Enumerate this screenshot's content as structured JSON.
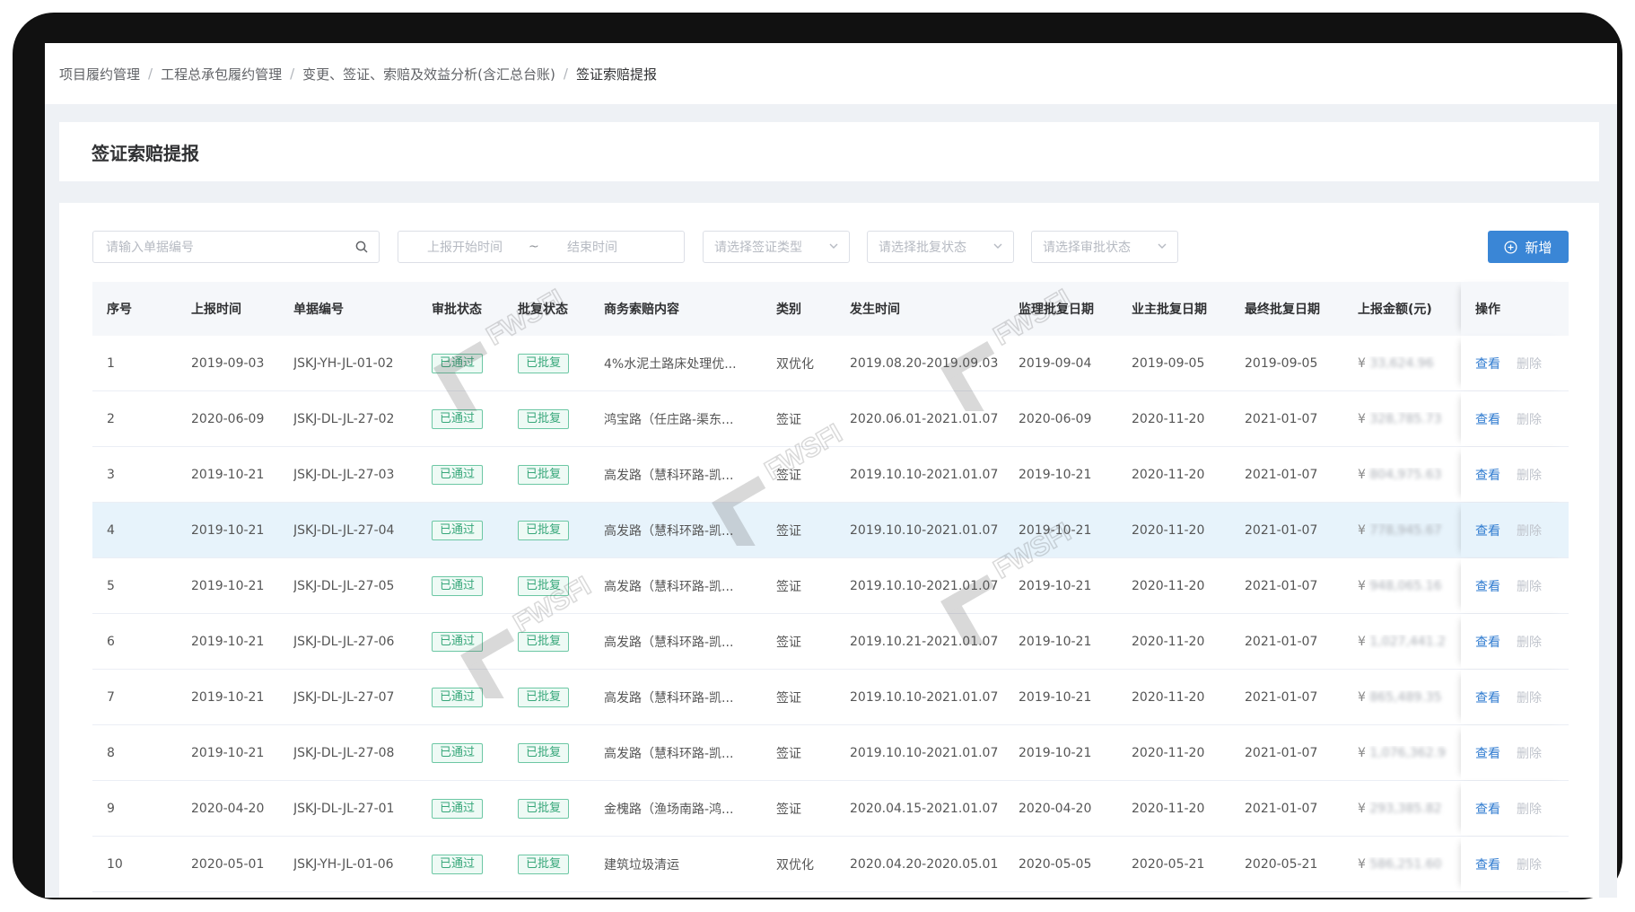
{
  "breadcrumb": [
    "项目履约管理",
    "工程总承包履约管理",
    "变更、签证、索赔及效益分析(含汇总台账)",
    "签证索赔提报"
  ],
  "page_title": "签证索赔提报",
  "filters": {
    "search_placeholder": "请输入单据编号",
    "start_placeholder": "上报开始时间",
    "range_sep": "~",
    "end_placeholder": "结束时间",
    "type_placeholder": "请选择签证类型",
    "reply_placeholder": "请选择批复状态",
    "approval_placeholder": "请选择审批状态",
    "add_label": "新增"
  },
  "columns": [
    "序号",
    "上报时间",
    "单据编号",
    "审批状态",
    "批复状态",
    "商务索赔内容",
    "类别",
    "发生时间",
    "监理批复日期",
    "业主批复日期",
    "最终批复日期",
    "上报金额(元)",
    "操作"
  ],
  "actions": {
    "view": "查看",
    "delete": "删除"
  },
  "currency": "¥",
  "watermark_text": "FWSFI",
  "rows": [
    {
      "no": "1",
      "date": "2019-09-03",
      "code": "JSKJ-YH-JL-01-02",
      "approval": "已通过",
      "reply": "已批复",
      "content": "4%水泥土路床处理优...",
      "category": "双优化",
      "period": "2019.08.20-2019.09.03",
      "supervisor_date": "2019-09-04",
      "owner_date": "2019-09-05",
      "final_date": "2019-09-05",
      "amount": "33,624.96"
    },
    {
      "no": "2",
      "date": "2020-06-09",
      "code": "JSKJ-DL-JL-27-02",
      "approval": "已通过",
      "reply": "已批复",
      "content": "鸿宝路（任庄路-渠东...",
      "category": "签证",
      "period": "2020.06.01-2021.01.07",
      "supervisor_date": "2020-06-09",
      "owner_date": "2020-11-20",
      "final_date": "2021-01-07",
      "amount": "328,785.73"
    },
    {
      "no": "3",
      "date": "2019-10-21",
      "code": "JSKJ-DL-JL-27-03",
      "approval": "已通过",
      "reply": "已批复",
      "content": "高发路（慧科环路-凯...",
      "category": "签证",
      "period": "2019.10.10-2021.01.07",
      "supervisor_date": "2019-10-21",
      "owner_date": "2020-11-20",
      "final_date": "2021-01-07",
      "amount": "804,975.63"
    },
    {
      "no": "4",
      "date": "2019-10-21",
      "code": "JSKJ-DL-JL-27-04",
      "approval": "已通过",
      "reply": "已批复",
      "content": "高发路（慧科环路-凯...",
      "category": "签证",
      "period": "2019.10.10-2021.01.07",
      "supervisor_date": "2019-10-21",
      "owner_date": "2020-11-20",
      "final_date": "2021-01-07",
      "amount": "778,945.67"
    },
    {
      "no": "5",
      "date": "2019-10-21",
      "code": "JSKJ-DL-JL-27-05",
      "approval": "已通过",
      "reply": "已批复",
      "content": "高发路（慧科环路-凯...",
      "category": "签证",
      "period": "2019.10.10-2021.01.07",
      "supervisor_date": "2019-10-21",
      "owner_date": "2020-11-20",
      "final_date": "2021-01-07",
      "amount": "948,065.16"
    },
    {
      "no": "6",
      "date": "2019-10-21",
      "code": "JSKJ-DL-JL-27-06",
      "approval": "已通过",
      "reply": "已批复",
      "content": "高发路（慧科环路-凯...",
      "category": "签证",
      "period": "2019.10.21-2021.01.07",
      "supervisor_date": "2019-10-21",
      "owner_date": "2020-11-20",
      "final_date": "2021-01-07",
      "amount": "1,027,441.2"
    },
    {
      "no": "7",
      "date": "2019-10-21",
      "code": "JSKJ-DL-JL-27-07",
      "approval": "已通过",
      "reply": "已批复",
      "content": "高发路（慧科环路-凯...",
      "category": "签证",
      "period": "2019.10.10-2021.01.07",
      "supervisor_date": "2019-10-21",
      "owner_date": "2020-11-20",
      "final_date": "2021-01-07",
      "amount": "865,489.35"
    },
    {
      "no": "8",
      "date": "2019-10-21",
      "code": "JSKJ-DL-JL-27-08",
      "approval": "已通过",
      "reply": "已批复",
      "content": "高发路（慧科环路-凯...",
      "category": "签证",
      "period": "2019.10.10-2021.01.07",
      "supervisor_date": "2019-10-21",
      "owner_date": "2020-11-20",
      "final_date": "2021-01-07",
      "amount": "1,076,362.9"
    },
    {
      "no": "9",
      "date": "2020-04-20",
      "code": "JSKJ-DL-JL-27-01",
      "approval": "已通过",
      "reply": "已批复",
      "content": "金槐路（渔场南路-鸿...",
      "category": "签证",
      "period": "2020.04.15-2021.01.07",
      "supervisor_date": "2020-04-20",
      "owner_date": "2020-11-20",
      "final_date": "2021-01-07",
      "amount": "293,385.82"
    },
    {
      "no": "10",
      "date": "2020-05-01",
      "code": "JSKJ-YH-JL-01-06",
      "approval": "已通过",
      "reply": "已批复",
      "content": "建筑垃圾清运",
      "category": "双优化",
      "period": "2020.04.20-2020.05.01",
      "supervisor_date": "2020-05-05",
      "owner_date": "2020-05-21",
      "final_date": "2020-05-21",
      "amount": "586,251.60"
    }
  ],
  "colors": {
    "primary": "#3a86d6",
    "tag_green": "#37a77a",
    "highlight_row": "#e7f3fb"
  }
}
